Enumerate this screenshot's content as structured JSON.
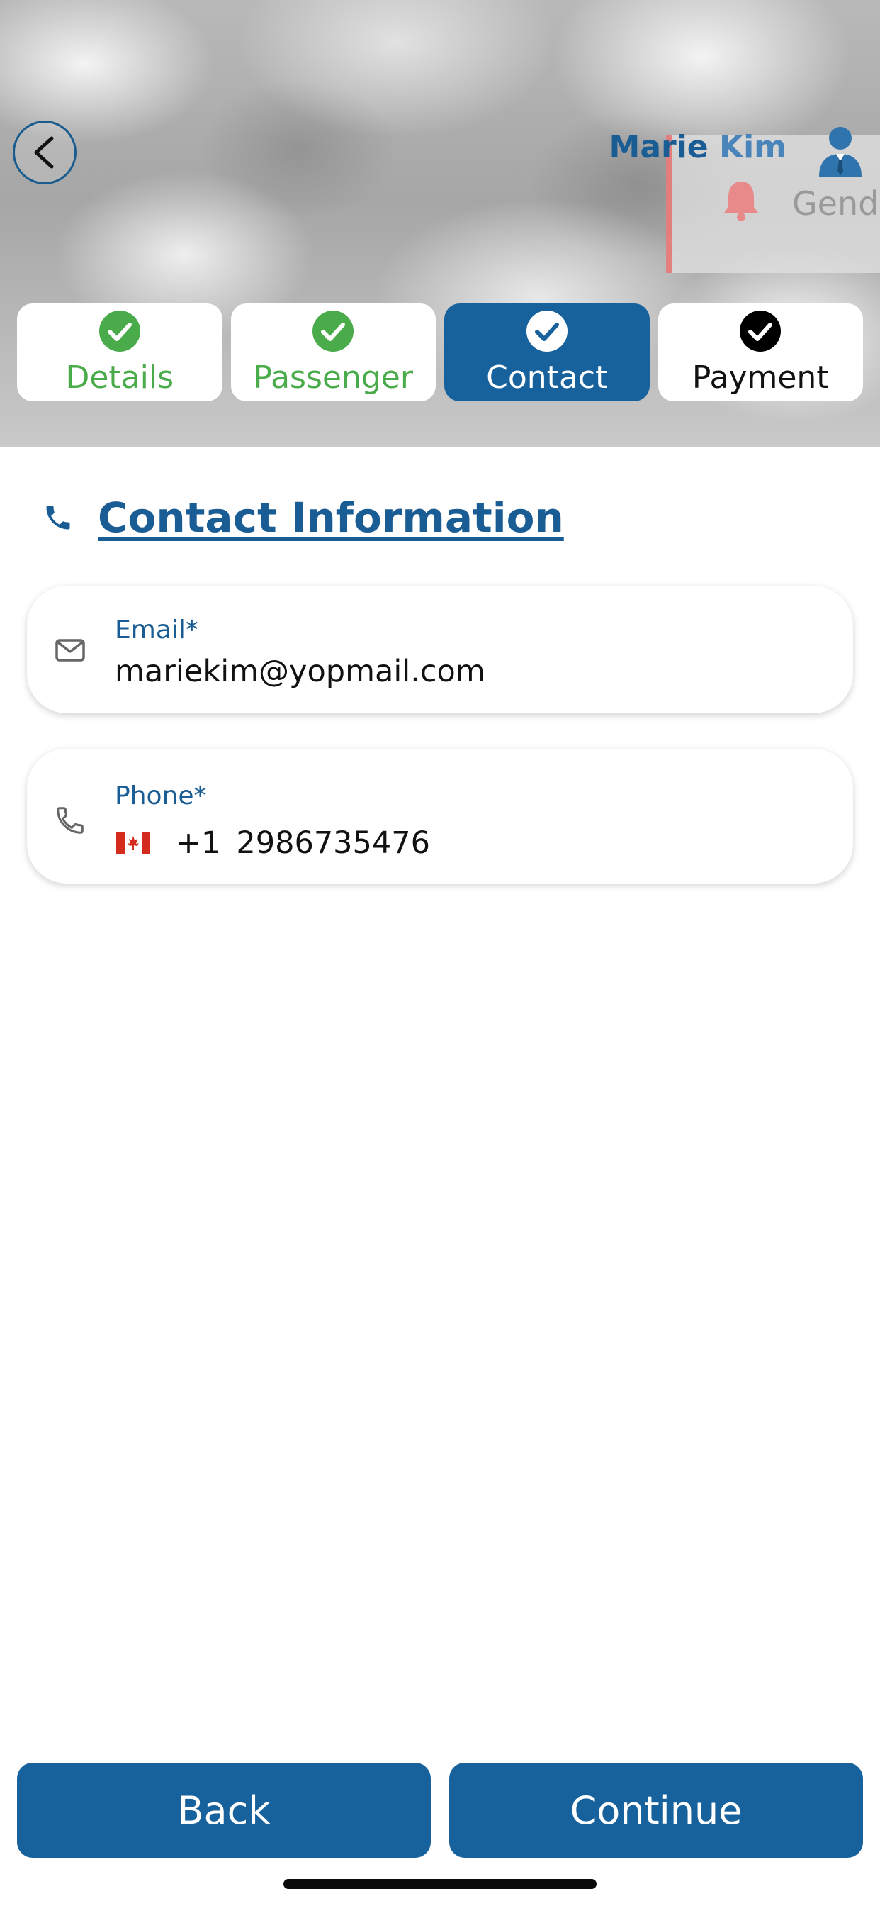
{
  "header": {
    "user_first_name": "Marie",
    "user_last_name": "Kim",
    "notification_text": "Gend"
  },
  "stepper": {
    "steps": [
      {
        "label": "Details",
        "state": "done"
      },
      {
        "label": "Passenger",
        "state": "done"
      },
      {
        "label": "Contact",
        "state": "active"
      },
      {
        "label": "Payment",
        "state": "todo"
      }
    ]
  },
  "section": {
    "title": "Contact Information",
    "icon": "phone-icon"
  },
  "email_field": {
    "label": "Email*",
    "value": "mariekim@yopmail.com",
    "icon": "mail-icon"
  },
  "phone_field": {
    "label": "Phone*",
    "country_flag": "canada-flag-icon",
    "dial_code": "+1",
    "number": "2986735476",
    "icon": "phone-icon"
  },
  "buttons": {
    "back_label": "Back",
    "continue_label": "Continue"
  },
  "colors": {
    "primary": "#17629c",
    "success": "#4aab4a",
    "accent_red": "#e57070"
  }
}
